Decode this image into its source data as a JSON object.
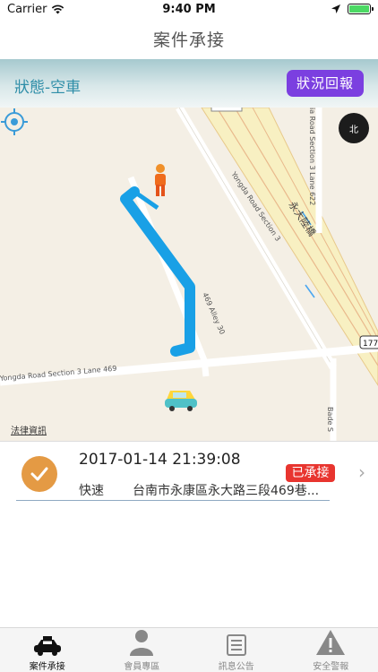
{
  "statusbar": {
    "carrier": "Carrier",
    "time": "9:40 PM"
  },
  "header": {
    "title": "案件承接"
  },
  "status_strip": {
    "status": "狀態-空車",
    "report_button": "狀況回報"
  },
  "map": {
    "streets": {
      "yongda_section3": "Yongda Road Section 3",
      "yongda_lane469": "Yongda Road Section 3 Lane 469",
      "lane622": "ia Road Section 3 Lane 622",
      "bade": "Bade S",
      "alley": "469 Alley 30",
      "bridge": "永大陸橋",
      "route": "177"
    },
    "compass_label": "北",
    "legal": "法律資訊"
  },
  "case": {
    "datetime": "2017-01-14 21:39:08",
    "status_badge": "已承接",
    "type": "快速",
    "address": "台南市永康區永大路三段469巷..."
  },
  "tabs": [
    {
      "label": "案件承接",
      "icon": "taxi-icon"
    },
    {
      "label": "會員專區",
      "icon": "person-icon"
    },
    {
      "label": "訊息公告",
      "icon": "list-icon"
    },
    {
      "label": "安全警報",
      "icon": "warning-icon"
    }
  ],
  "colors": {
    "accent_purple": "#7b3fe0",
    "status_teal": "#2f8ea8",
    "badge_red": "#e8352f",
    "check_orange": "#e49a44",
    "route_blue": "#19a0e6"
  }
}
